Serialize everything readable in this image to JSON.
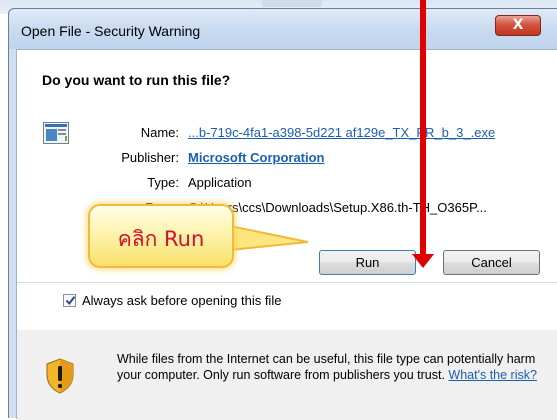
{
  "window": {
    "title": "Open File - Security Warning",
    "close_label": "X"
  },
  "dialog": {
    "question": "Do you want to run this file?",
    "fields": {
      "name_label": "Name:",
      "name_value": "...b-719c-4fa1-a398-5d221  af129e_TX_PR_b_3_.exe",
      "publisher_label": "Publisher:",
      "publisher_value": "Microsoft Corporation",
      "type_label": "Type:",
      "type_value": "Application",
      "from_label": "From:",
      "from_value": "C:\\Users\\ccs\\Downloads\\Setup.X86.th-TH_O365P..."
    },
    "buttons": {
      "run": "Run",
      "cancel": "Cancel"
    },
    "checkbox": {
      "label": "Always ask before opening this file",
      "checked": true
    },
    "warning": {
      "text": "While files from the Internet can be useful, this file type can potentially harm your computer. Only run software from publishers you trust.",
      "link": "What's the risk?"
    }
  },
  "annotation": {
    "callout_text": "คลิก Run",
    "arrow_color": "#e00000"
  },
  "icons": [
    "file-icon",
    "shield-warning-icon",
    "checkmark-icon",
    "close-icon"
  ]
}
